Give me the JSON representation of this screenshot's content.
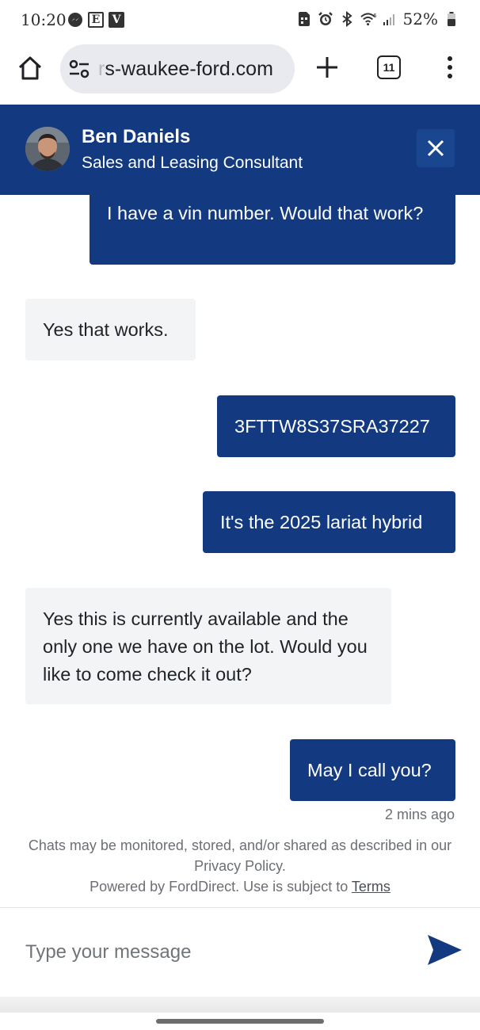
{
  "status_bar": {
    "time": "10:20",
    "left_icons": [
      "messenger-icon",
      "e-icon",
      "v-icon"
    ],
    "right_icons": [
      "sim-icon",
      "alarm-icon",
      "bluetooth-icon",
      "wifi-icon",
      "signal-icon",
      "battery-icon"
    ],
    "battery": "52%",
    "e_label": "E",
    "v_label": "V"
  },
  "browser": {
    "url_faded": "r",
    "url": "s-waukee-ford.com",
    "tab_count": "11"
  },
  "chat_header": {
    "agent_name": "Ben Daniels",
    "agent_title": "Sales and Leasing Consultant",
    "header_color": "#133a80"
  },
  "messages": [
    {
      "sender": "user",
      "text": "I have a vin number. Would that work?"
    },
    {
      "sender": "agent",
      "text": "Yes that works."
    },
    {
      "sender": "user",
      "text": "3FTTW8S37SRA37227"
    },
    {
      "sender": "user",
      "text": "It's the 2025 lariat hybrid"
    },
    {
      "sender": "agent",
      "text": "Yes this is currently available and the only one we have on the lot. Would you like to come check it out?"
    },
    {
      "sender": "user",
      "text": "May I call you?"
    }
  ],
  "last_message_time": "2 mins ago",
  "disclaimer": {
    "line1": "Chats may be monitored, stored, and/or shared as described in our Privacy Policy.",
    "powered_prefix": "Powered by FordDirect. Use is subject to ",
    "terms_label": "Terms"
  },
  "composer": {
    "placeholder": "Type your message"
  },
  "colors": {
    "brand": "#133a80",
    "agent_bubble": "#f3f4f5"
  }
}
